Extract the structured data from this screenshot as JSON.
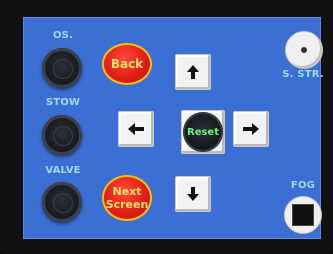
{
  "left_controls": {
    "os_label": "OS.",
    "stow_label": "STOW",
    "valve_label": "VALVE"
  },
  "buttons": {
    "back_label": "Back",
    "next_label_line1": "Next",
    "next_label_line2": "Screen",
    "reset_label": "Reset"
  },
  "right_controls": {
    "sstr_label": "S. STR.",
    "fog_label": "FOG"
  },
  "icons": {
    "up": "arrow-up-icon",
    "down": "arrow-down-icon",
    "left": "arrow-left-icon",
    "right": "arrow-right-icon"
  },
  "colors": {
    "screen_bg": "#3b6fd4",
    "label_text": "#9fd9f3",
    "oval_red": "#e21f16",
    "oval_border": "#f2c200",
    "oval_text": "#ffe36a",
    "reset_text": "#6ff07a"
  }
}
